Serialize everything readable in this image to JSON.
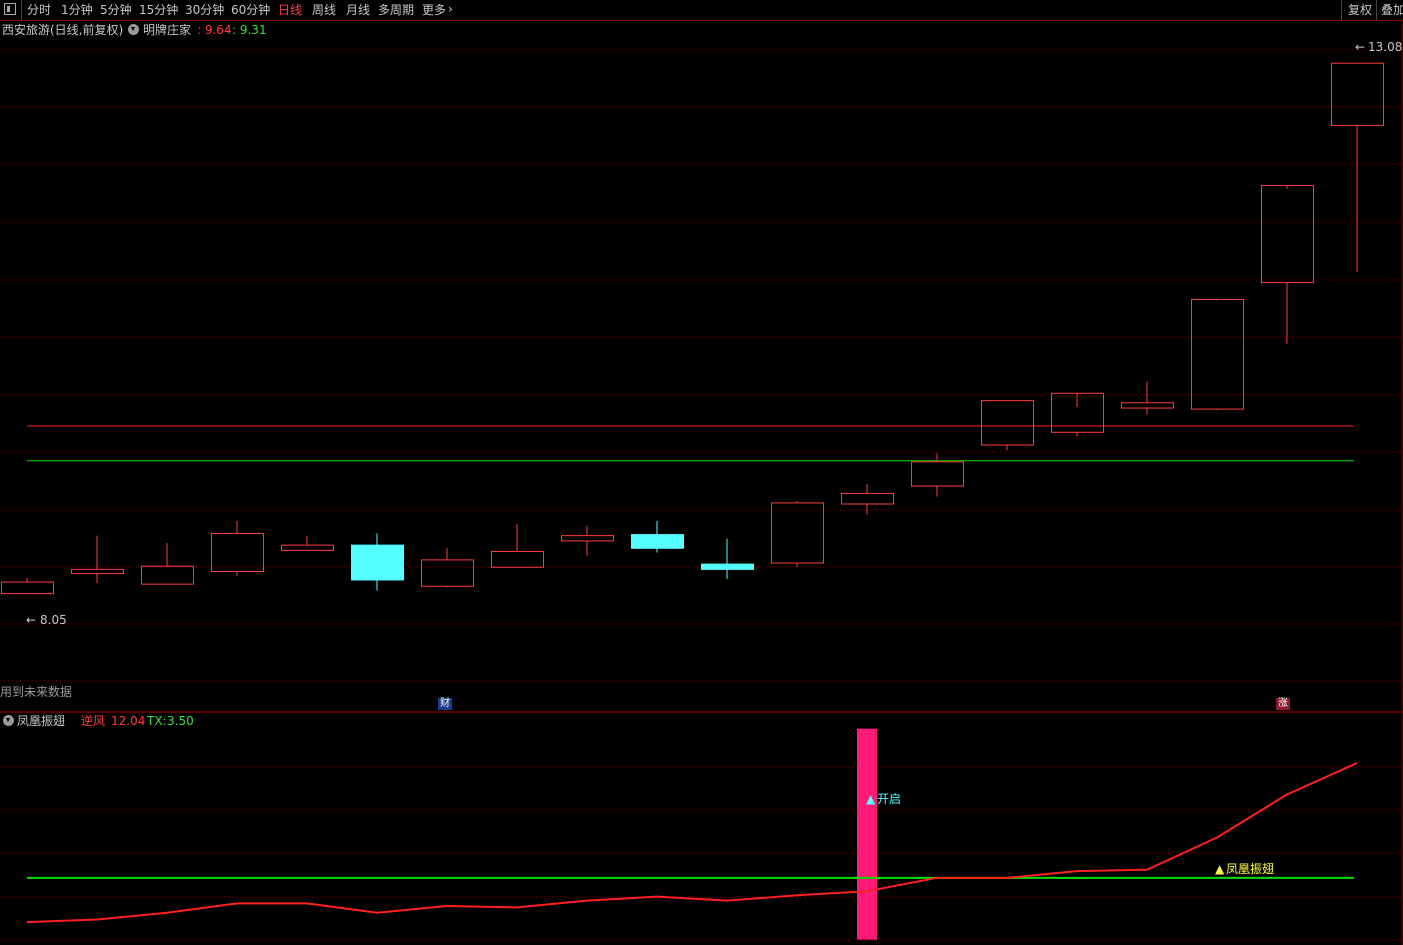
{
  "toolbar": {
    "periods": [
      "分时",
      "1分钟",
      "5分钟",
      "15分钟",
      "30分钟",
      "60分钟",
      "日线",
      "周线",
      "月线",
      "多周期",
      "更多"
    ],
    "active": "日线",
    "right_buttons": [
      "复权",
      "叠加"
    ]
  },
  "main_header": {
    "stock": "西安旅游(日线,前复权)",
    "indicator": "明牌庄家",
    "val_red": ": 9.64",
    "val_green": ": 9.31"
  },
  "sub_header": {
    "indicator": "凤凰振翅",
    "name_red": "逆风",
    "val_red": "12.04",
    "name_green": "TX:",
    "val_green": "3.50"
  },
  "warning_text": "用到未来数据",
  "markers": {
    "cai": "财",
    "zhang": "涨",
    "kaiqi": "开启",
    "fenghuang": "凤凰振翅"
  },
  "price_labels": {
    "high": "13.08",
    "low": "8.05"
  },
  "colors": {
    "up": "#ff3c3c",
    "down": "#54ffff",
    "line_red": "#ff2020",
    "line_green": "#00e000",
    "bar_pink": "#ff1a7a",
    "grid": "#7a0000"
  },
  "chart_data": [
    {
      "type": "candlestick",
      "title": "西安旅游(日线,前复权)",
      "price_range": [
        7.8,
        13.3
      ],
      "hlines": [
        {
          "name": "明牌庄家",
          "value": 9.64,
          "color": "#ff2020"
        },
        {
          "name": "明牌庄家",
          "value": 9.31,
          "color": "#00e000"
        }
      ],
      "candles": [
        {
          "o": 8.05,
          "h": 8.2,
          "l": 8.05,
          "c": 8.16
        },
        {
          "o": 8.24,
          "h": 8.6,
          "l": 8.15,
          "c": 8.28
        },
        {
          "o": 8.14,
          "h": 8.53,
          "l": 8.14,
          "c": 8.31
        },
        {
          "o": 8.26,
          "h": 8.74,
          "l": 8.22,
          "c": 8.62
        },
        {
          "o": 8.46,
          "h": 8.6,
          "l": 8.46,
          "c": 8.51
        },
        {
          "o": 8.51,
          "h": 8.62,
          "l": 8.08,
          "c": 8.18
        },
        {
          "o": 8.12,
          "h": 8.48,
          "l": 8.11,
          "c": 8.37
        },
        {
          "o": 8.3,
          "h": 8.71,
          "l": 8.3,
          "c": 8.45
        },
        {
          "o": 8.55,
          "h": 8.69,
          "l": 8.41,
          "c": 8.6
        },
        {
          "o": 8.61,
          "h": 8.74,
          "l": 8.44,
          "c": 8.48
        },
        {
          "o": 8.33,
          "h": 8.57,
          "l": 8.19,
          "c": 8.28
        },
        {
          "o": 8.34,
          "h": 8.93,
          "l": 8.3,
          "c": 8.91
        },
        {
          "o": 8.9,
          "h": 9.09,
          "l": 8.8,
          "c": 9.0
        },
        {
          "o": 9.07,
          "h": 9.38,
          "l": 8.97,
          "c": 9.3
        },
        {
          "o": 9.46,
          "h": 9.88,
          "l": 9.41,
          "c": 9.88
        },
        {
          "o": 9.58,
          "h": 9.82,
          "l": 9.54,
          "c": 9.95
        },
        {
          "o": 9.81,
          "h": 10.06,
          "l": 9.75,
          "c": 9.86
        },
        {
          "o": 9.8,
          "h": 10.83,
          "l": 9.79,
          "c": 10.84
        },
        {
          "o": 11.0,
          "h": 11.89,
          "l": 10.42,
          "c": 11.92
        },
        {
          "o": 12.49,
          "h": 13.08,
          "l": 11.1,
          "c": 13.08
        }
      ]
    },
    {
      "type": "line",
      "title": "凤凰振翅",
      "y_range": [
        -1.5,
        14.5
      ],
      "series": [
        {
          "name": "逆风",
          "color": "#ff2020",
          "values": [
            0.2,
            0.4,
            0.9,
            1.6,
            1.6,
            0.9,
            1.4,
            1.3,
            1.8,
            2.1,
            1.8,
            2.2,
            2.5,
            3.5,
            3.5,
            4.0,
            4.1,
            6.5,
            9.7,
            12.04
          ]
        },
        {
          "name": "TX",
          "color": "#00e000",
          "values": [
            3.5
          ]
        }
      ],
      "signal_bar": {
        "index": 12,
        "low": -1.1,
        "high": 14.6
      }
    }
  ]
}
